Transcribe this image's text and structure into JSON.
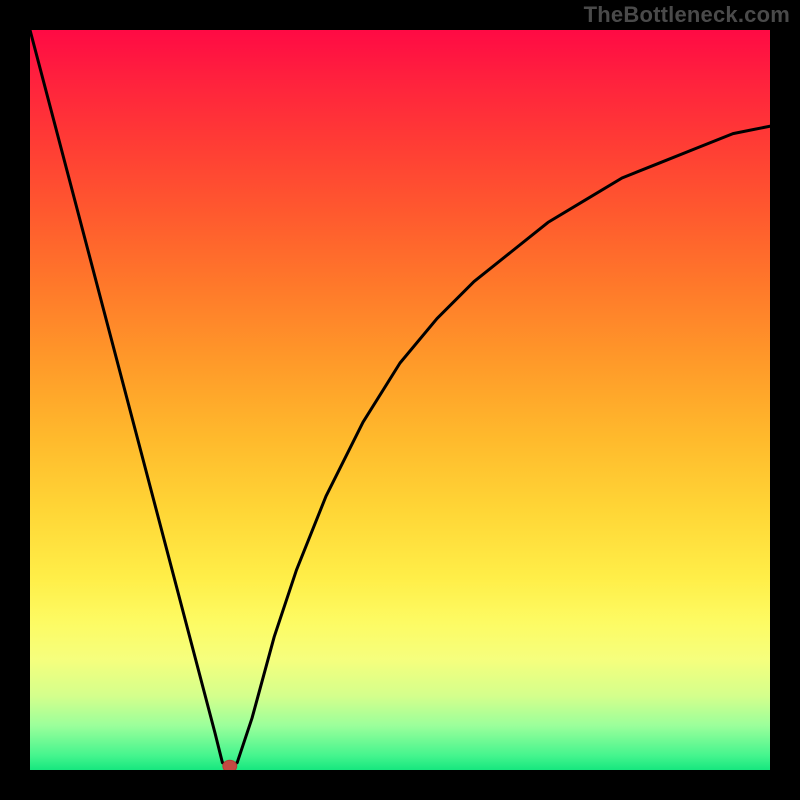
{
  "watermark": "TheBottleneck.com",
  "chart_data": {
    "type": "line",
    "title": "",
    "xlabel": "",
    "ylabel": "",
    "xlim": [
      0,
      100
    ],
    "ylim": [
      0,
      100
    ],
    "legend": false,
    "grid": false,
    "background": "vertical-gradient red→yellow→green",
    "series": [
      {
        "name": "bottleneck-curve",
        "x": [
          0,
          5,
          10,
          15,
          20,
          25,
          26,
          27,
          28,
          30,
          33,
          36,
          40,
          45,
          50,
          55,
          60,
          65,
          70,
          75,
          80,
          85,
          90,
          95,
          100
        ],
        "y": [
          100,
          81,
          62,
          43,
          24,
          5,
          1,
          0.5,
          1,
          7,
          18,
          27,
          37,
          47,
          55,
          61,
          66,
          70,
          74,
          77,
          80,
          82,
          84,
          86,
          87
        ]
      }
    ],
    "annotations": [
      {
        "name": "minimum-marker",
        "x": 27,
        "y": 0.5
      }
    ]
  },
  "colors": {
    "page_bg": "#000000",
    "curve": "#000000",
    "marker": "#c24a42",
    "watermark": "#4a4a4a"
  }
}
